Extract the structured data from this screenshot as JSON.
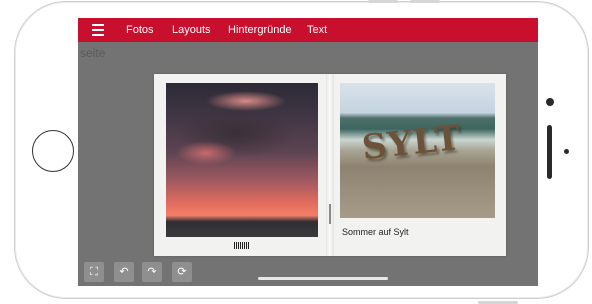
{
  "toolbar": {
    "menu_icon": "hamburger-menu-icon",
    "tabs": [
      "Fotos",
      "Layouts",
      "Hintergründe",
      "Text"
    ]
  },
  "page_label": "seite",
  "spread": {
    "caption": "Sommer auf Sylt",
    "photo_right_word": "SYLT"
  },
  "tools": [
    {
      "icon": "fullscreen-icon",
      "glyph": "⛶"
    },
    {
      "icon": "undo-icon",
      "glyph": "↶"
    },
    {
      "icon": "redo-icon",
      "glyph": "↷"
    },
    {
      "icon": "magic-icon",
      "glyph": "⟳"
    }
  ],
  "colors": {
    "accent": "#c8102e",
    "canvas_bg": "#737373"
  }
}
